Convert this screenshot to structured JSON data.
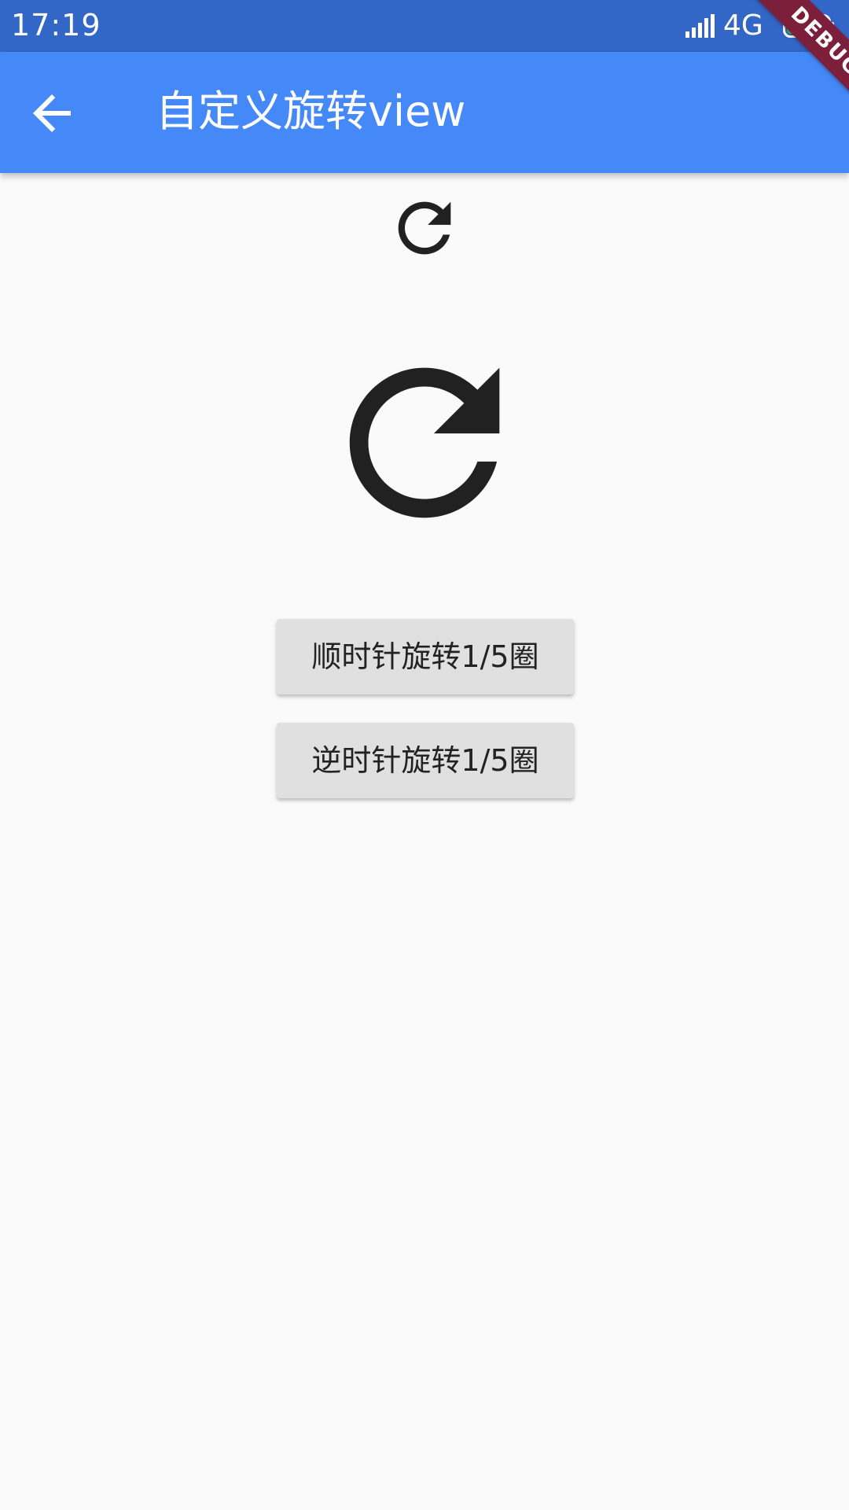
{
  "status_bar": {
    "time": "17:19",
    "network": "4G",
    "battery": "100",
    "signal_icon": "signal-bars-icon",
    "battery_icon": "battery-full-icon",
    "background": "#3367c7"
  },
  "app_bar": {
    "title": "自定义旋转view",
    "back_icon": "arrow-back-icon",
    "background": "#4589f8"
  },
  "debug_banner": {
    "label": "DEBUG",
    "color": "#7c1f3a"
  },
  "content": {
    "small_icon": "refresh-icon",
    "large_icon": "refresh-icon",
    "icon_color": "#212121",
    "buttons": [
      {
        "label": "顺时针旋转1/5圈"
      },
      {
        "label": "逆时针旋转1/5圈"
      }
    ]
  }
}
